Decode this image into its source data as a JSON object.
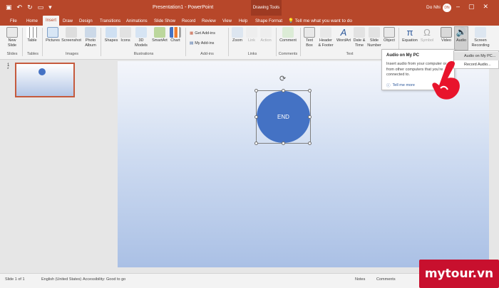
{
  "title_bar": {
    "document_title": "Presentation1 - PowerPoint",
    "contextual_tab_group": "Drawing Tools",
    "user_name": "Do Nhi",
    "user_initials": "DN"
  },
  "tabs": [
    {
      "label": "File"
    },
    {
      "label": "Home"
    },
    {
      "label": "Insert"
    },
    {
      "label": "Draw"
    },
    {
      "label": "Design"
    },
    {
      "label": "Transitions"
    },
    {
      "label": "Animations"
    },
    {
      "label": "Slide Show"
    },
    {
      "label": "Record"
    },
    {
      "label": "Review"
    },
    {
      "label": "View"
    },
    {
      "label": "Help"
    },
    {
      "label": "Shape Format"
    }
  ],
  "active_tab": "Insert",
  "tell_me": "Tell me what you want to do",
  "ribbon": {
    "buttons": [
      {
        "label": "New\nSlide"
      },
      {
        "label": "Table"
      },
      {
        "label": "Pictures"
      },
      {
        "label": "Screenshot"
      },
      {
        "label": "Photo\nAlbum"
      },
      {
        "label": "Shapes"
      },
      {
        "label": "Icons"
      },
      {
        "label": "3D\nModels"
      },
      {
        "label": "SmartArt"
      },
      {
        "label": "Chart"
      },
      {
        "label": "Zoom"
      },
      {
        "label": "Link"
      },
      {
        "label": "Action"
      },
      {
        "label": "Comment"
      },
      {
        "label": "Text\nBox"
      },
      {
        "label": "Header\n& Footer"
      },
      {
        "label": "WordArt"
      },
      {
        "label": "Date &\nTime"
      },
      {
        "label": "Slide\nNumber"
      },
      {
        "label": "Object"
      },
      {
        "label": "Equation"
      },
      {
        "label": "Symbol"
      },
      {
        "label": "Video"
      },
      {
        "label": "Audio"
      },
      {
        "label": "Screen\nRecording"
      }
    ],
    "addins": {
      "get": "Get Add-ins",
      "my": "My Add-ins"
    },
    "groups": [
      {
        "label": "Slides"
      },
      {
        "label": "Tables"
      },
      {
        "label": "Images"
      },
      {
        "label": "Illustrations"
      },
      {
        "label": "Add-ins"
      },
      {
        "label": "Links"
      },
      {
        "label": "Comments"
      },
      {
        "label": "Text"
      }
    ]
  },
  "thumbnail": {
    "number": "1",
    "marker": "*"
  },
  "slide": {
    "shape_text": "END"
  },
  "audio_menu": {
    "items": [
      {
        "label": "Audio on My PC..."
      },
      {
        "label": "Record Audio..."
      }
    ]
  },
  "tooltip": {
    "title": "Audio on My PC",
    "description": "Insert audio from your computer or from other computers that you're connected to.",
    "link": "Tell me more"
  },
  "status_bar": {
    "slide_info": "Slide 1 of 1",
    "language": "English (United States)",
    "accessibility": "Accessibility: Good to go",
    "notes": "Notes",
    "comments": "Comments"
  },
  "watermark": "mytour.vn",
  "colors": {
    "accent": "#b7472a",
    "shape_fill": "#4472c4"
  }
}
